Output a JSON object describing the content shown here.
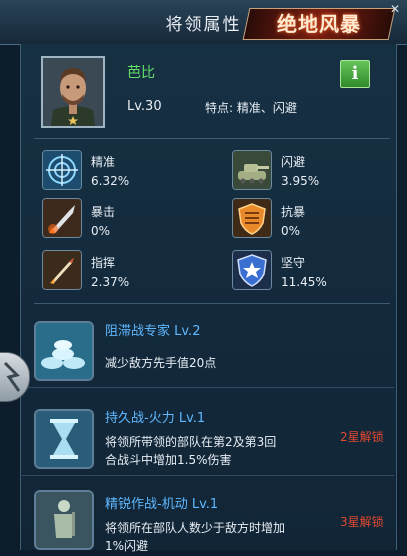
{
  "header": {
    "title": "将领属性",
    "logo_text": "绝地风暴"
  },
  "general": {
    "name": "芭比",
    "level": "Lv.30",
    "traits": "特点: 精准、闪避"
  },
  "stats": [
    {
      "name": "精准",
      "value": "6.32%",
      "icon": "crosshair-radar-icon"
    },
    {
      "name": "闪避",
      "value": "3.95%",
      "icon": "tank-icon"
    },
    {
      "name": "暴击",
      "value": "0%",
      "icon": "missile-icon"
    },
    {
      "name": "抗暴",
      "value": "0%",
      "icon": "shield-wing-icon"
    },
    {
      "name": "指挥",
      "value": "2.37%",
      "icon": "rocket-icon"
    },
    {
      "name": "坚守",
      "value": "11.45%",
      "icon": "star-shield-icon"
    }
  ],
  "skills": [
    {
      "title": "阻滞战专家 Lv.2",
      "desc1": "减少敌方先手值20点",
      "desc2": "",
      "locked": "",
      "icon": "sandbag-icon"
    },
    {
      "title": "持久战-火力 Lv.1",
      "desc1": "将领所带领的部队在第2及第3回",
      "desc2": "合战斗中增加1.5%伤害",
      "locked": "2星解锁",
      "icon": "hourglass-icon"
    },
    {
      "title": "精锐作战-机动 Lv.1",
      "desc1": "将领所在部队人数少于敌方时增加",
      "desc2": "1%闪避",
      "locked": "3星解锁",
      "icon": "soldier-icon"
    }
  ],
  "colors": {
    "accent_green": "#63e06a",
    "skill_title": "#5fb8ff",
    "lock_red": "#e04830"
  }
}
